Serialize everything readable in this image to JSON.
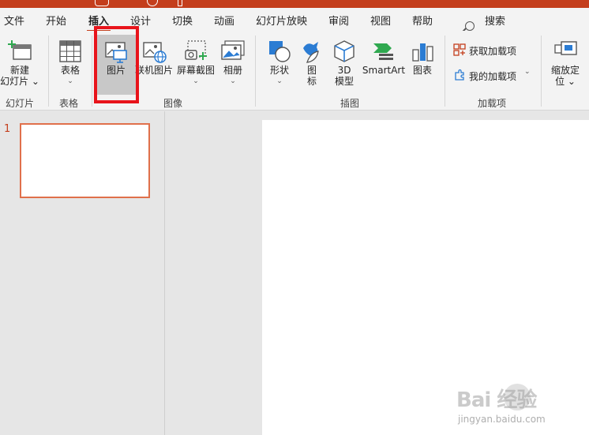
{
  "menu": {
    "tabs": [
      "文件",
      "开始",
      "插入",
      "设计",
      "切换",
      "动画",
      "幻灯片放映",
      "审阅",
      "视图",
      "帮助"
    ],
    "search_label": "搜索"
  },
  "ribbon": {
    "new_slide": {
      "line1": "新建",
      "line2": "幻灯片 ⌄"
    },
    "table": "表格",
    "picture": "图片",
    "online_picture": "联机图片",
    "screenshot": "屏幕截图",
    "album": "相册",
    "shapes": "形状",
    "icons": {
      "line1": "图",
      "line2": "标"
    },
    "model3d": {
      "line1": "3D",
      "line2": "模型"
    },
    "smartart": "SmartArt",
    "chart": "图表",
    "get_addins": "获取加载项",
    "my_addins": "我的加载项",
    "zoom": {
      "line1": "缩放定",
      "line2": "位 ⌄"
    },
    "chevron": "⌄",
    "groups": {
      "slides": "幻灯片",
      "tables": "表格",
      "images": "图像",
      "illustrations": "插图",
      "addins": "加载项"
    }
  },
  "slides_panel": {
    "number": "1"
  },
  "watermark": {
    "text": "Bai 经验",
    "url": "jingyan.baidu.com"
  },
  "colors": {
    "accent": "#c43e1c",
    "highlight": "#e8141b",
    "icon_blue": "#2b7cd3"
  }
}
